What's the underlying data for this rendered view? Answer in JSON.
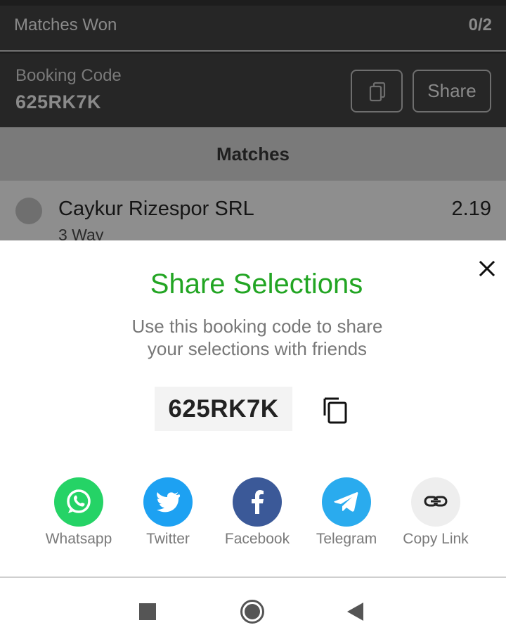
{
  "background": {
    "matches_won": {
      "label": "Matches Won",
      "value": "0/2"
    },
    "booking": {
      "label": "Booking Code",
      "code": "625RK7K",
      "share_label": "Share"
    },
    "matches_header": "Matches",
    "match": {
      "team": "Caykur Rizespor SRL",
      "odds": "2.19",
      "market": "3 Way"
    }
  },
  "sheet": {
    "title": "Share Selections",
    "subtitle_line1": "Use this booking code to share",
    "subtitle_line2": "your selections with friends",
    "code": "625RK7K",
    "share_options": [
      {
        "label": "Whatsapp",
        "icon": "whatsapp-icon",
        "color": "#25d366"
      },
      {
        "label": "Twitter",
        "icon": "twitter-icon",
        "color": "#1da1f2"
      },
      {
        "label": "Facebook",
        "icon": "facebook-icon",
        "color": "#3b5998"
      },
      {
        "label": "Telegram",
        "icon": "telegram-icon",
        "color": "#2aabee"
      },
      {
        "label": "Copy Link",
        "icon": "link-icon",
        "color": "#eeeeee"
      }
    ]
  },
  "colors": {
    "title_green": "#22a523"
  },
  "navbar": {
    "buttons": [
      "recents-icon",
      "home-icon",
      "back-icon"
    ]
  }
}
